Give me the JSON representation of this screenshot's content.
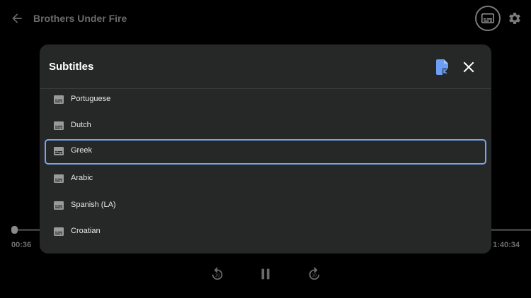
{
  "player": {
    "title": "Brothers Under Fire",
    "time_current": "00:36",
    "time_total": "1:40:34",
    "progress_fraction": 0.006
  },
  "dialog": {
    "title": "Subtitles",
    "items": [
      {
        "label": "Portuguese",
        "selected": false
      },
      {
        "label": "Dutch",
        "selected": false
      },
      {
        "label": "Greek",
        "selected": true
      },
      {
        "label": "Arabic",
        "selected": false
      },
      {
        "label": "Spanish (LA)",
        "selected": false
      },
      {
        "label": "Croatian",
        "selected": false
      }
    ]
  },
  "icons": {
    "back": "arrow-back-icon",
    "captions": "closed-caption-icon",
    "settings": "gear-icon",
    "upload": "subtitle-file-upload-icon",
    "close": "close-icon",
    "item": "subtitles-icon",
    "rewind": "replay-10-icon",
    "pause": "pause-icon",
    "forward": "forward-10-icon"
  },
  "colors": {
    "accent": "#7aa4f2",
    "upload_icon": "#6c9ef5",
    "dialog_bg": "#262827"
  }
}
